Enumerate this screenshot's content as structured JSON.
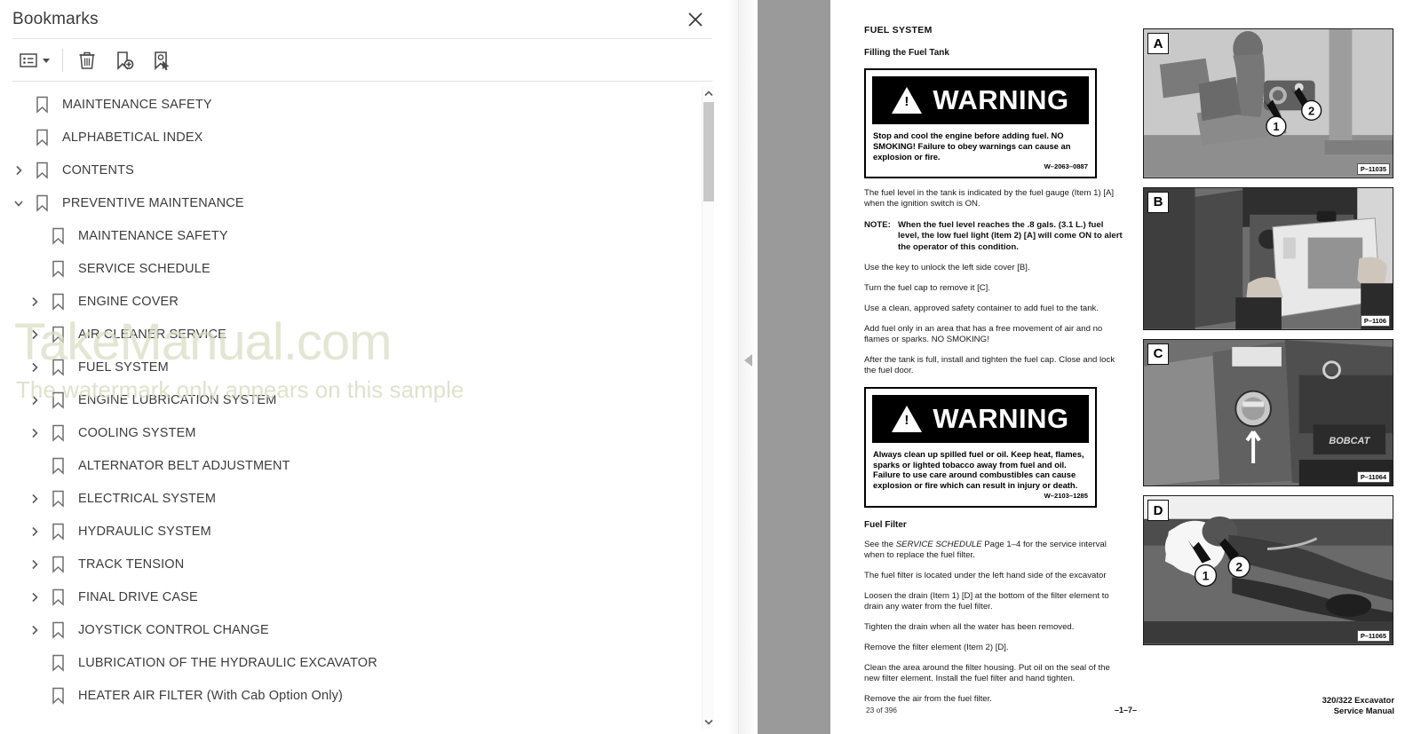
{
  "panel": {
    "title": "Bookmarks",
    "close_icon": "close-icon",
    "toolbar": {
      "options_icon": "list-options-icon",
      "caret_icon": "chevron-down-icon",
      "delete_icon": "trash-icon",
      "add_bookmark_icon": "add-bookmark-icon",
      "select_bookmark_icon": "select-bookmark-icon"
    },
    "scrollbar": {
      "up_icon": "chevron-up-icon",
      "down_icon": "chevron-down-icon"
    },
    "collapse_icon": "collapse-left-icon"
  },
  "watermark": {
    "main": "TakeManual.com",
    "sub": "The watermark only appears on this sample"
  },
  "bookmarks": [
    {
      "label": "MAINTENANCE SAFETY",
      "level": 0,
      "twisty": "none"
    },
    {
      "label": "ALPHABETICAL INDEX",
      "level": 0,
      "twisty": "none"
    },
    {
      "label": "CONTENTS",
      "level": 0,
      "twisty": "collapsed"
    },
    {
      "label": "PREVENTIVE MAINTENANCE",
      "level": 0,
      "twisty": "expanded"
    },
    {
      "label": "MAINTENANCE SAFETY",
      "level": 1,
      "twisty": "none"
    },
    {
      "label": "SERVICE SCHEDULE",
      "level": 1,
      "twisty": "none"
    },
    {
      "label": "ENGINE COVER",
      "level": 1,
      "twisty": "collapsed"
    },
    {
      "label": "AIR CLEANER SERVICE",
      "level": 1,
      "twisty": "collapsed"
    },
    {
      "label": "FUEL SYSTEM",
      "level": 1,
      "twisty": "collapsed"
    },
    {
      "label": "ENGINE LUBRICATION SYSTEM",
      "level": 1,
      "twisty": "collapsed"
    },
    {
      "label": "COOLING SYSTEM",
      "level": 1,
      "twisty": "collapsed"
    },
    {
      "label": "ALTERNATOR BELT ADJUSTMENT",
      "level": 1,
      "twisty": "none"
    },
    {
      "label": "ELECTRICAL SYSTEM",
      "level": 1,
      "twisty": "collapsed"
    },
    {
      "label": "HYDRAULIC SYSTEM",
      "level": 1,
      "twisty": "collapsed"
    },
    {
      "label": "TRACK TENSION",
      "level": 1,
      "twisty": "collapsed"
    },
    {
      "label": "FINAL DRIVE CASE",
      "level": 1,
      "twisty": "collapsed"
    },
    {
      "label": "JOYSTICK CONTROL CHANGE",
      "level": 1,
      "twisty": "collapsed"
    },
    {
      "label": "LUBRICATION OF THE HYDRAULIC EXCAVATOR",
      "level": 1,
      "twisty": "none"
    },
    {
      "label": "HEATER AIR FILTER (With Cab Option Only)",
      "level": 1,
      "twisty": "none"
    }
  ],
  "document": {
    "section_title": "FUEL SYSTEM",
    "subsection_title": "Filling the Fuel Tank",
    "warning1": {
      "word": "WARNING",
      "text": "Stop  and cool the engine before adding fuel. NO  SMOKING! Failure to obey warnings    can cause an explosion or fire.",
      "code": "W–2063–0887"
    },
    "para1": "The fuel level in the tank is indicated by the fuel gauge (Item 1) [A] when the ignition switch is ON.",
    "note_label": "NOTE:",
    "note_text": "When the fuel level reaches the .8 gals. (3.1 L.) fuel level, the low fuel light (Item 2) [A] will come   ON to alert the operator of this condition.",
    "para2": "Use the key to unlock the left side cover [B].",
    "para3": "Turn the fuel cap to remove it [C].",
    "para4": "Use a clean, approved safety container to add fuel to the tank.",
    "para5": "Add fuel only in an area that has a free movement of air and no flames or sparks. NO SMOKING!",
    "para6": "After the tank is full, install and tighten the fuel cap. Close and lock the fuel door.",
    "warning2": {
      "word": "WARNING",
      "text": "Always clean up spilled fuel or oil. Keep heat, flames, sparks or lighted tobacco away from fuel   and oil. Failure to          use   care   around combustibles   can cause explosion or fire which can result in injury or death.",
      "code": "W–2103–1285"
    },
    "filter_title": "Fuel Filter",
    "filter_para1_a": "See the ",
    "filter_para1_ital": "SERVICE SCHEDULE",
    "filter_para1_b": " Page 1–4 for the service interval when to replace the fuel filter.",
    "filter_para2": "The fuel filter is located under the left hand side of the excavator",
    "filter_para3": "Loosen the drain (Item 1)  [D] at the bottom of the filter element to drain any water from the fuel filter.",
    "filter_para4": "Tighten the drain when all the water has been removed.",
    "filter_para5": "Remove the filter element (Item 2) [D].",
    "filter_para6": "Clean the area around the filter housing. Put   oil on the seal of the new filter element. Install the fuel filter and hand tighten.",
    "filter_para7": "Remove the air from the fuel filter.",
    "photos": [
      {
        "tag": "A",
        "code": "P–11035",
        "callouts": [
          "1",
          "2"
        ]
      },
      {
        "tag": "B",
        "code": "P–1106",
        "callouts": []
      },
      {
        "tag": "C",
        "code": "P–11064",
        "callouts": []
      },
      {
        "tag": "D",
        "code": "P–11065",
        "callouts": [
          "1",
          "2"
        ]
      }
    ],
    "footer": {
      "page_count": "23 of 396",
      "page_number": "–1–7–",
      "manual_line1": "320/322 Excavator",
      "manual_line2": "Service Manual"
    }
  }
}
